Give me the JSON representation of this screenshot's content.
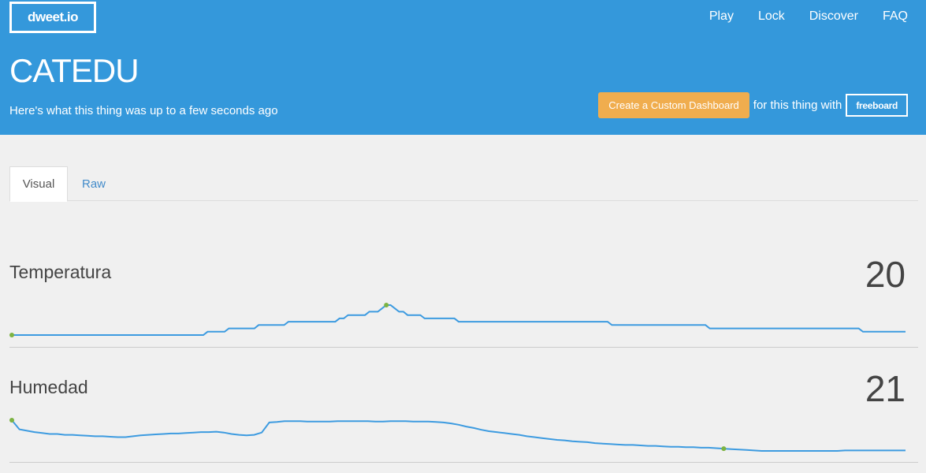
{
  "header": {
    "logo": "dweet.io",
    "nav": [
      "Play",
      "Lock",
      "Discover",
      "FAQ"
    ],
    "thing_name": "CATEDU",
    "subtitle": "Here's what this thing was up to a few seconds ago",
    "cta_button": "Create a Custom Dashboard",
    "cta_text": "for this thing with",
    "freeboard_label": "freeboard"
  },
  "tabs": [
    "Visual",
    "Raw"
  ],
  "metrics": [
    {
      "name": "Temperatura",
      "value": "20",
      "series": [
        18,
        18,
        18,
        18,
        18,
        18,
        18,
        18,
        18,
        18,
        18,
        18,
        18,
        18,
        18,
        18,
        18,
        18,
        18,
        18,
        18,
        18,
        18,
        18,
        18,
        18,
        18,
        18,
        18,
        18,
        18,
        18,
        18,
        18,
        18,
        18,
        18,
        18,
        18,
        18,
        18,
        18,
        18,
        18,
        18,
        18,
        18.5,
        18.5,
        18.5,
        18.5,
        18.5,
        19,
        19,
        19,
        19,
        19,
        19,
        19,
        19.5,
        19.5,
        19.5,
        19.5,
        19.5,
        19.5,
        19.5,
        20,
        20,
        20,
        20,
        20,
        20,
        20,
        20,
        20,
        20,
        20,
        20,
        20.5,
        20.5,
        21,
        21,
        21,
        21,
        21,
        21.5,
        21.5,
        21.5,
        22,
        22.5,
        22.5,
        22,
        21.5,
        21.5,
        21,
        21,
        21,
        21,
        20.5,
        20.5,
        20.5,
        20.5,
        20.5,
        20.5,
        20.5,
        20.5,
        20,
        20,
        20,
        20,
        20,
        20,
        20,
        20,
        20,
        20,
        20,
        20,
        20,
        20,
        20,
        20,
        20,
        20,
        20,
        20,
        20,
        20,
        20,
        20,
        20,
        20,
        20,
        20,
        20,
        20,
        20,
        20,
        20,
        20,
        20,
        20,
        19.5,
        19.5,
        19.5,
        19.5,
        19.5,
        19.5,
        19.5,
        19.5,
        19.5,
        19.5,
        19.5,
        19.5,
        19.5,
        19.5,
        19.5,
        19.5,
        19.5,
        19.5,
        19.5,
        19.5,
        19.5,
        19.5,
        19.5,
        19,
        19,
        19,
        19,
        19,
        19,
        19,
        19,
        19,
        19,
        19,
        19,
        19,
        19,
        19,
        19,
        19,
        19,
        19,
        19,
        19,
        19,
        19,
        19,
        19,
        19,
        19,
        19,
        19,
        19,
        19,
        19,
        19,
        19,
        19,
        19,
        18.5,
        18.5,
        18.5,
        18.5,
        18.5,
        18.5,
        18.5,
        18.5,
        18.5,
        18.5,
        18.5
      ],
      "min_index": 0,
      "max_index": 88
    },
    {
      "name": "Humedad",
      "value": "21",
      "series": [
        28,
        26,
        25.7,
        25.4,
        25.2,
        25,
        25,
        24.8,
        24.8,
        24.7,
        24.6,
        24.5,
        24.5,
        24.4,
        24.3,
        24.3,
        24.5,
        24.7,
        24.8,
        24.9,
        25,
        25.1,
        25.1,
        25.2,
        25.3,
        25.4,
        25.4,
        25.5,
        25.3,
        25,
        24.8,
        24.7,
        24.8,
        25.3,
        27.5,
        27.6,
        27.8,
        27.8,
        27.8,
        27.7,
        27.7,
        27.7,
        27.7,
        27.8,
        27.8,
        27.8,
        27.8,
        27.8,
        27.7,
        27.7,
        27.8,
        27.8,
        27.8,
        27.7,
        27.7,
        27.7,
        27.6,
        27.5,
        27.3,
        27,
        26.6,
        26.3,
        25.9,
        25.6,
        25.4,
        25.2,
        25,
        24.8,
        24.5,
        24.3,
        24.1,
        23.9,
        23.7,
        23.6,
        23.4,
        23.3,
        23.2,
        23,
        22.9,
        22.8,
        22.7,
        22.6,
        22.6,
        22.5,
        22.4,
        22.4,
        22.3,
        22.2,
        22.2,
        22.1,
        22.1,
        22,
        22,
        21.9,
        21.8,
        21.7,
        21.6,
        21.5,
        21.4,
        21.3,
        21.3,
        21.3,
        21.3,
        21.3,
        21.3,
        21.3,
        21.3,
        21.3,
        21.3,
        21.3,
        21.4,
        21.4,
        21.4,
        21.4,
        21.4,
        21.4,
        21.4,
        21.4,
        21.4
      ],
      "min_index": 94,
      "max_index": 0
    }
  ],
  "colors": {
    "header_bg": "#3498db",
    "line": "#3d9be0",
    "marker": "#7cb342",
    "cta_bg": "#f0ad4e",
    "tab_link": "#428bca"
  },
  "icons": []
}
